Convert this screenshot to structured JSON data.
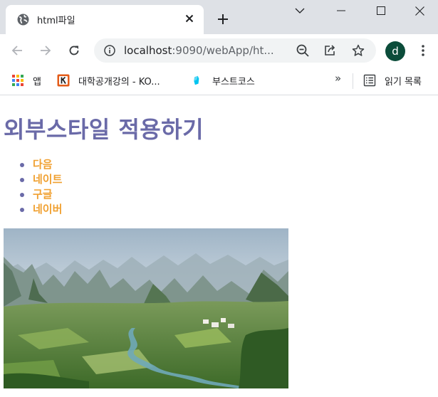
{
  "browser": {
    "tab": {
      "title": "html파일",
      "favicon": "globe-icon"
    },
    "address": {
      "host": "localhost",
      "rest": ":9090/webApp/ht..."
    },
    "profile_initial": "d",
    "bookmarks": [
      {
        "label": "앱",
        "icon": "apps-grid-icon"
      },
      {
        "label": "대학공개강의 - KO...",
        "icon": "kocw-icon"
      },
      {
        "label": "부스트코스",
        "icon": "boostcourse-icon"
      }
    ],
    "overflow": "»",
    "reading_list": {
      "label": "읽기 목록",
      "icon": "reading-list-icon"
    }
  },
  "page": {
    "title": "외부스타일 적용하기",
    "links": [
      "다음",
      "네이트",
      "구글",
      "네이버"
    ]
  },
  "colors": {
    "heading": "#6a6aa8",
    "link": "#f0a030",
    "bullet": "#6a6aa8",
    "avatar": "#0b4c3a",
    "tabstrip": "#dee1e6"
  }
}
